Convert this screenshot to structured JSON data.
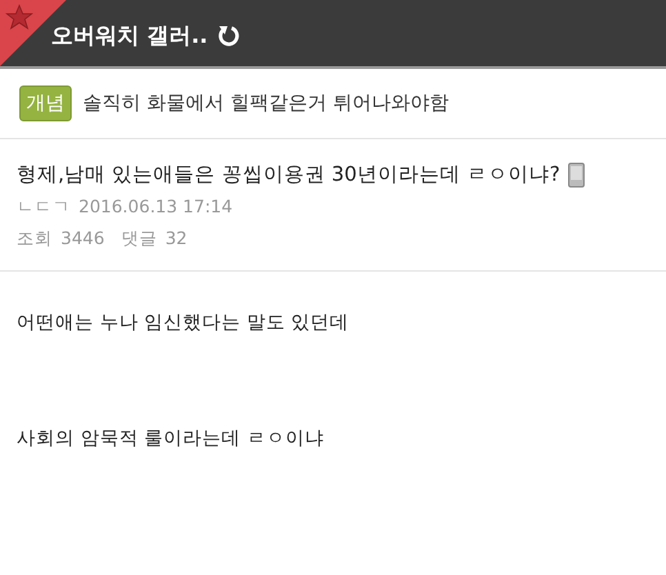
{
  "header": {
    "title": "오버워치 갤러.."
  },
  "banner": {
    "tag": "개념",
    "text": "솔직히 화물에서 힐팩같은거 튀어나와야함"
  },
  "post": {
    "title": "형제,남매 있는애들은 꽁씹이용권 30년이라는데 ㄹㅇ이냐?",
    "author": "ㄴㄷㄱ",
    "date": "2016.06.13 17:14",
    "views_label": "조회",
    "views": "3446",
    "comments_label": "댓글",
    "comments": "32"
  },
  "body": [
    "어떤애는 누나 임신했다는 말도 있던데",
    "사회의 암묵적 룰이라는데 ㄹㅇ이냐"
  ]
}
